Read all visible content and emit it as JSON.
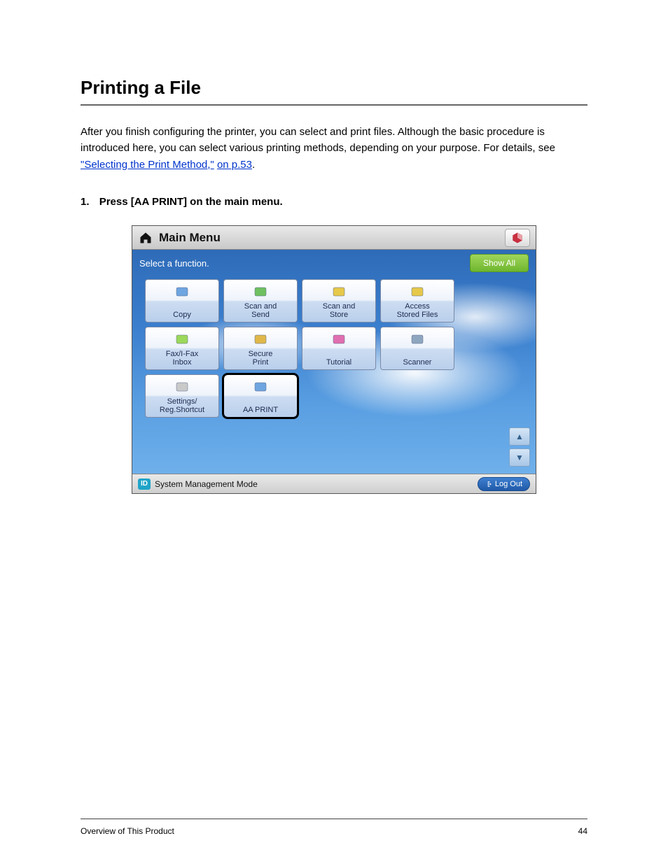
{
  "doc": {
    "section_title": "Printing a File",
    "intro_prefix": "After you finish configuring the printer, you can select and print files. Although the basic procedure is introduced here, you can select various printing methods, depending on your purpose. For details, see ",
    "intro_link": "\"Selecting the Print Method,\"",
    "intro_link_suffix": "on p.53",
    "intro_suffix": ".",
    "step_number": "1.",
    "step_text": "Press [AA PRINT] on the main menu."
  },
  "header": {
    "title": "Main Menu"
  },
  "prompt": "Select a function.",
  "show_all": "Show All",
  "functions": [
    {
      "name": "copy",
      "label": "Copy",
      "icon_color": "#6fa5e0"
    },
    {
      "name": "scan-and-send",
      "label": "Scan and\nSend",
      "icon_color": "#6fc060"
    },
    {
      "name": "scan-and-store",
      "label": "Scan and\nStore",
      "icon_color": "#e6c84a"
    },
    {
      "name": "access-stored-files",
      "label": "Access\nStored Files",
      "icon_color": "#e6c84a"
    },
    {
      "name": "fax-ifax-inbox",
      "label": "Fax/I-Fax\nInbox",
      "icon_color": "#9cd85a"
    },
    {
      "name": "secure-print",
      "label": "Secure\nPrint",
      "icon_color": "#e0b84a"
    },
    {
      "name": "tutorial",
      "label": "Tutorial",
      "icon_color": "#e06fb0"
    },
    {
      "name": "scanner",
      "label": "Scanner",
      "icon_color": "#8fa6bf"
    },
    {
      "name": "settings-reg-shortcut",
      "label": "Settings/\nReg.Shortcut",
      "icon_color": "#c9c9c9"
    },
    {
      "name": "aa-print",
      "label": "AA PRINT",
      "icon_color": "#6fa5e0",
      "highlight": true
    }
  ],
  "status": {
    "id_label": "ID",
    "mode": "System Management Mode",
    "logout": "Log Out"
  },
  "footer": {
    "left": "Overview of This Product",
    "page": "44"
  }
}
